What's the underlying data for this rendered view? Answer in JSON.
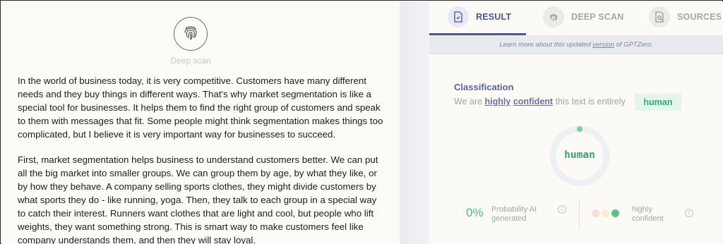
{
  "left_pane": {
    "scan_label": "Deep scan",
    "paragraphs": [
      "In the world of business today, it is very competitive. Customers have many different needs and they buy things in different ways. That's why market segmentation is like a special tool for businesses. It helps them to find the right group of customers and speak to them with messages that fit. Some people might think segmentation makes things too complicated, but I believe it is very important way for businesses to succeed.",
      "First, market segmentation helps business to understand customers better. We can put all the big market into smaller groups. We can group them by age, by what they like, or by how they behave. A company selling sports clothes, they might divide customers by what sports they do - like running, yoga. Then, they talk to each group in a special way to catch their interest. Runners want clothes that are light and cool, but people who lift weights, they want something strong. This is smart way to make customers feel like company understands them, and then they will stay loyal."
    ]
  },
  "tabs": [
    {
      "label": "RESULT",
      "icon": "document-icon",
      "active": true
    },
    {
      "label": "DEEP SCAN",
      "icon": "fingerprint-icon",
      "active": false
    },
    {
      "label": "SOURCES",
      "icon": "search-document-icon",
      "active": false
    }
  ],
  "banner": {
    "prefix": "Learn more about this updated ",
    "link": "version",
    "suffix": " of GPTZero."
  },
  "classification": {
    "title": "Classification",
    "line_start": "We are ",
    "confidence_word": "highly",
    "confident_word": "confident",
    "line_end": " this text is entirely",
    "result": "human",
    "ring_label": "human",
    "ring_fraction": 0.0
  },
  "stats": {
    "probability_value": "0%",
    "probability_label": "Probability AI generated",
    "confidence_label": "highly confident",
    "confidence_levels": [
      "#f6dcdc",
      "#f3efc9",
      "#5fbf88"
    ]
  },
  "colors": {
    "accent": "#4a55a6",
    "human_green": "#3aa56a"
  }
}
